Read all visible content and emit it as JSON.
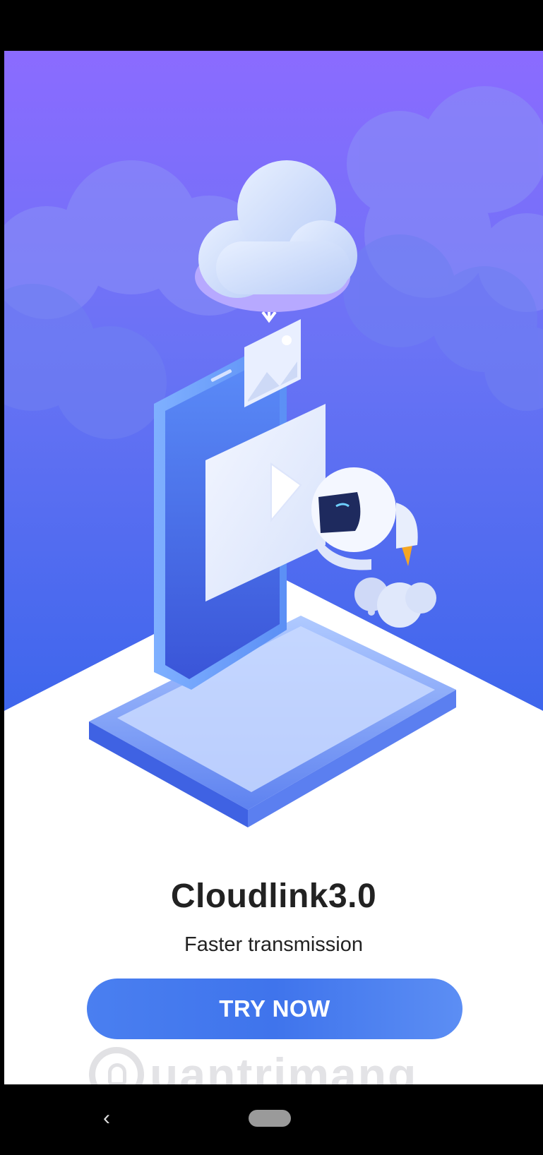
{
  "onboarding": {
    "title": "Cloudlink3.0",
    "subtitle": "Faster transmission",
    "cta_label": "TRY NOW"
  },
  "watermark": {
    "text": "uantrimang"
  },
  "nav": {
    "back_glyph": "‹"
  },
  "colors": {
    "sky_top": "#8a6cff",
    "sky_bottom": "#3f6cf0",
    "button": "#4a7ff0",
    "title_text": "#222222"
  },
  "icons": [
    "cloud-illustration",
    "phone-illustration",
    "robot-illustration",
    "back-icon",
    "home-pill-icon",
    "bulb-logo-icon"
  ]
}
